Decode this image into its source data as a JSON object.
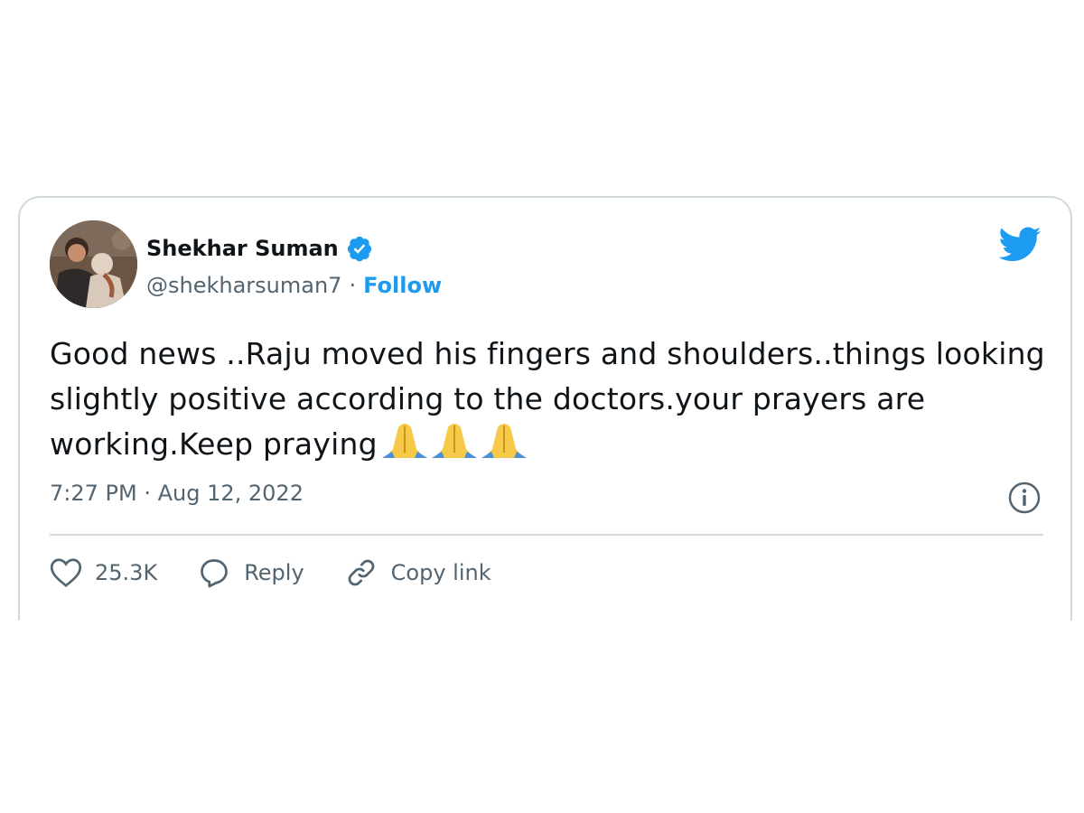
{
  "tweet": {
    "display_name": "Shekhar Suman",
    "handle": "@shekharsuman7",
    "separator": "·",
    "follow_label": "Follow",
    "text": "Good news ..Raju moved his fingers and shoulders..things looking slightly positive according to the doctors.your prayers are working.Keep praying",
    "emoji_count": 3,
    "emoji_name": "folded-hands-icon",
    "timestamp": "7:27 PM · Aug 12, 2022",
    "actions": {
      "like_count": "25.3K",
      "reply_label": "Reply",
      "copy_link_label": "Copy link"
    }
  },
  "icons": {
    "verified": "verified-badge-icon",
    "brand": "twitter-bird-icon",
    "info": "info-icon",
    "like": "heart-icon",
    "reply": "speech-bubble-icon",
    "copy": "link-icon"
  },
  "colors": {
    "brand": "#1d9bf0",
    "text": "#0f1419",
    "secondary_text": "#536471",
    "border": "#cfd9de"
  }
}
